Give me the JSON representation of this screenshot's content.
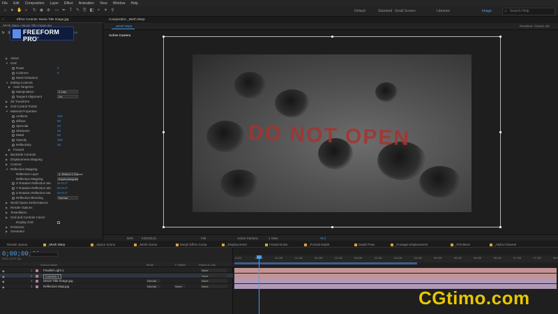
{
  "menu": [
    "File",
    "Edit",
    "Composition",
    "Layer",
    "Effect",
    "Animation",
    "View",
    "Window",
    "Help"
  ],
  "workspaces": [
    {
      "label": "Default",
      "active": false
    },
    {
      "label": "Standard",
      "active": false
    },
    {
      "label": "Small Screen",
      "active": false
    },
    {
      "label": "Libraries",
      "active": false
    },
    {
      "label": "Image",
      "active": true
    }
  ],
  "help_placeholder": "Search Help",
  "effect_controls": {
    "tab": "Effect Controls: Movie Title Image.jpg",
    "subtitle": "_Mesh Warp • Movie Title Image.jpg",
    "effect_name": "Freeform Pro",
    "reset": "Reset",
    "register": "Register...",
    "about": "About",
    "presets_label": "Animation Presets:",
    "presets_value": "None",
    "logo_title": "FREEFORM PRO",
    "logo_sub": "MOTTLE.COM",
    "props": [
      {
        "name": "About",
        "indent": 1,
        "arrow": "▶"
      },
      {
        "name": "Grid",
        "indent": 1,
        "arrow": "▼"
      },
      {
        "name": "Rows",
        "indent": 3,
        "value": "3",
        "sw": true
      },
      {
        "name": "Columns",
        "indent": 3,
        "value": "3",
        "sw": true
      },
      {
        "name": "Mesh Distortion",
        "indent": 3,
        "sw": true
      },
      {
        "name": "Editing Controls",
        "indent": 1,
        "arrow": "▼"
      },
      {
        "name": "Auto Tangents",
        "indent": 2,
        "arrow": "▶"
      },
      {
        "name": "Manipulation",
        "indent": 3,
        "dropdown": "Z only",
        "sw": true
      },
      {
        "name": "Tangent Alignment",
        "indent": 3,
        "dropdown": "On",
        "sw": true
      },
      {
        "name": "3D Transform",
        "indent": 1,
        "arrow": "▶"
      },
      {
        "name": "Grid Control Points",
        "indent": 1,
        "arrow": "▶"
      },
      {
        "name": "Material Properties",
        "indent": 1,
        "arrow": "▼"
      },
      {
        "name": "Ambient",
        "indent": 3,
        "value": "100",
        "sw": true
      },
      {
        "name": "Diffuse",
        "indent": 3,
        "value": "50",
        "sw": true
      },
      {
        "name": "Specular",
        "indent": 3,
        "value": "40",
        "sw": true
      },
      {
        "name": "Shininess",
        "indent": 3,
        "value": "15",
        "sw": true
      },
      {
        "name": "Metal",
        "indent": 3,
        "value": "64",
        "sw": true
      },
      {
        "name": "Opacity",
        "indent": 3,
        "value": "100",
        "sw": true
      },
      {
        "name": "Reflectivity",
        "indent": 3,
        "value": "25",
        "sw": true
      },
      {
        "name": "Fresnel",
        "indent": 2,
        "arrow": "▶"
      },
      {
        "name": "Backside Controls",
        "indent": 1,
        "arrow": "▶"
      },
      {
        "name": "Displacement Mapping",
        "indent": 1,
        "arrow": "▶"
      },
      {
        "name": "Contour",
        "indent": 1,
        "arrow": "▶"
      },
      {
        "name": "Reflection Mapping",
        "indent": 1,
        "arrow": "▼"
      },
      {
        "name": "Reflection Layer",
        "indent": 3,
        "dropdown": "4. Reflect ∨  Source"
      },
      {
        "name": "Reflection Mapping",
        "indent": 3,
        "dropdown": "Equirectangular"
      },
      {
        "name": "X Rotation Reflection Ma",
        "indent": 3,
        "value": "0x+0.0°",
        "sw": true
      },
      {
        "name": "Y Rotation Reflection Ma",
        "indent": 3,
        "value": "0x+0.0°",
        "sw": true
      },
      {
        "name": "Z Rotation Reflection Ma",
        "indent": 3,
        "value": "0x+0.0°",
        "sw": true
      },
      {
        "name": "Reflection Blending",
        "indent": 3,
        "dropdown": "Normal",
        "sw": true
      },
      {
        "name": "World Space Deformations",
        "indent": 1,
        "arrow": "▶"
      },
      {
        "name": "Render Options",
        "indent": 1,
        "arrow": "▶"
      },
      {
        "name": "Tessellation",
        "indent": 1,
        "arrow": "▶"
      },
      {
        "name": "Grid and Controls Colors",
        "indent": 1,
        "arrow": "▶"
      },
      {
        "name": "Display Grid",
        "indent": 3
      },
      {
        "name": "Primitives",
        "indent": 1,
        "arrow": "▶"
      },
      {
        "name": "Generator",
        "indent": 1,
        "arrow": "▶"
      }
    ]
  },
  "composition": {
    "tab": "Composition _Mesh Warp",
    "subtab": "_Mesh Warp",
    "renderer": "Renderer: Classic 3D",
    "active_camera": "Active Camera",
    "image_text": "DO NOT OPEN"
  },
  "viewer_footer": {
    "zoom": "50%",
    "timecode": "0;00;00;21",
    "resolution": "Full",
    "camera": "Active Camera",
    "views": "1 View",
    "exposure": "+0.0"
  },
  "timeline_tabs": [
    {
      "label": "Render Queue",
      "color": "",
      "active": false
    },
    {
      "label": "_Mesh Warp",
      "color": "#d8a23a",
      "active": true
    },
    {
      "label": "_Space Scene",
      "color": "#d8a23a",
      "active": false
    },
    {
      "label": "_Mesh Scene",
      "color": "#d8a23a",
      "active": false
    },
    {
      "label": "Morph Effect Comp",
      "color": "#d8a23a",
      "active": false
    },
    {
      "label": "_Displacement",
      "color": "#d8a23a",
      "active": false
    },
    {
      "label": "Fractal Noise",
      "color": "#d8a23a",
      "active": false
    },
    {
      "label": "_Portrait Depth",
      "color": "#d8a23a",
      "active": false
    },
    {
      "label": "Depth Pass",
      "color": "#d8a23a",
      "active": false
    },
    {
      "label": "_Footage Displacement",
      "color": "#d8a23a",
      "active": false
    },
    {
      "label": "_Primitives",
      "color": "#d8a23a",
      "active": false
    },
    {
      "label": "_Alpha Channel",
      "color": "#d8a23a",
      "active": false
    }
  ],
  "timeline": {
    "timecode": "0;00;00;21",
    "timecode_sub": "00021 (29.97 fps)",
    "columns": [
      "Source Name",
      "Mode",
      "T TrkMat",
      "Parent & Link"
    ],
    "layers": [
      {
        "num": "1",
        "name": "Parallel Light 1",
        "color": "#c77a7a",
        "mode": "",
        "track": "",
        "parent": "None"
      },
      {
        "num": "2",
        "name": "Camera 1",
        "color": "#c77a7a",
        "mode": "",
        "track": "",
        "parent": "None"
      },
      {
        "num": "3",
        "name": "Movie Title Image.jpg",
        "color": "#b07aa8",
        "mode": "Normal",
        "track": "",
        "parent": "None"
      },
      {
        "num": "4",
        "name": "Reflection Map.jpg",
        "color": "#b07aa8",
        "mode": "Normal",
        "track": "None",
        "parent": "None"
      }
    ],
    "ruler": [
      "0:00f",
      "00:15f",
      "01:00f",
      "01:15f",
      "02:00f",
      "02:15f",
      "03:00f",
      "03:15f",
      "04:00f",
      "04:15f",
      "05:00f",
      "05:15f",
      "06:00f",
      "06:15f",
      "07:00f",
      "07:15f",
      "08:0"
    ],
    "bar_colors": [
      "#c49393",
      "#c49393",
      "#b09ab8",
      "#b09ab8"
    ]
  },
  "watermark": "CGtimo.com",
  "colors": {
    "accent": "#4c9fe8",
    "watermark": "#e8c700",
    "stencil": "#a8322e"
  }
}
